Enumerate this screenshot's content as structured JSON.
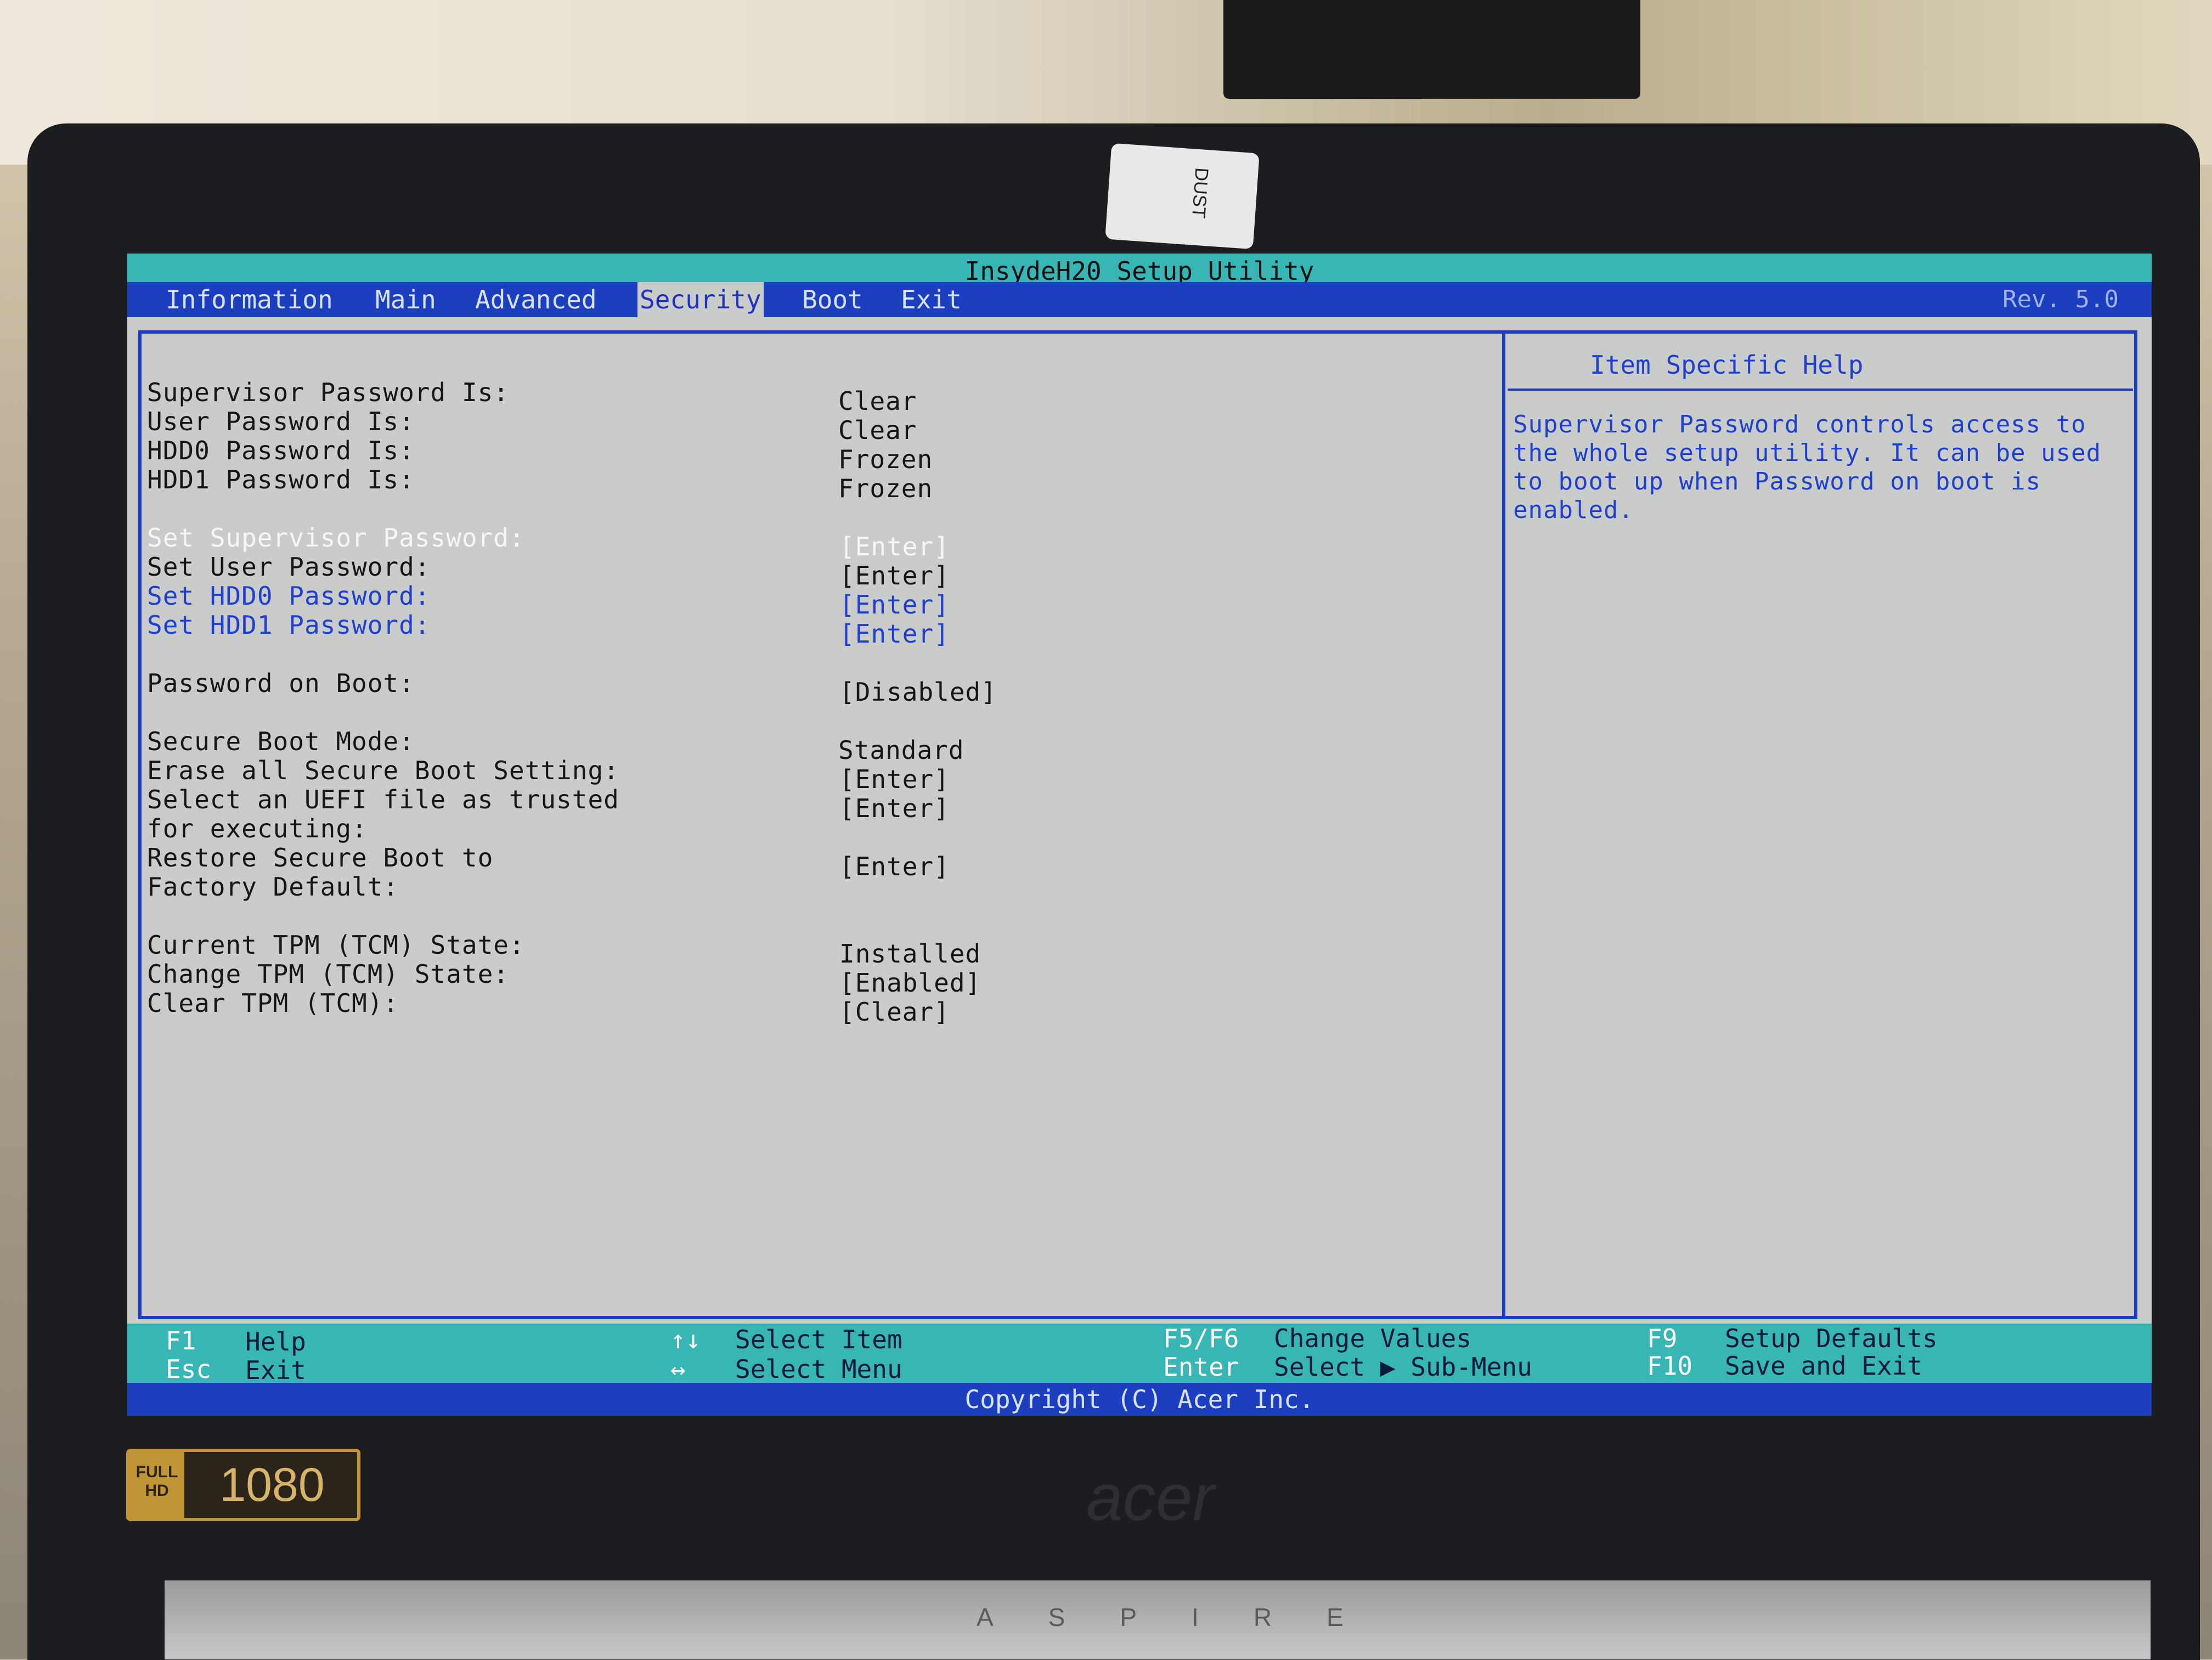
{
  "window_title": "InsydeH20 Setup Utility",
  "revision": "Rev. 5.0",
  "tabs": [
    {
      "label": "Information"
    },
    {
      "label": "Main"
    },
    {
      "label": "Advanced"
    },
    {
      "label": "Security",
      "active": true
    },
    {
      "label": "Boot"
    },
    {
      "label": "Exit"
    }
  ],
  "settings": [
    {
      "label": "Supervisor Password Is:",
      "value": "Clear"
    },
    {
      "label": "User Password Is:",
      "value": "Clear"
    },
    {
      "label": "HDD0 Password Is:",
      "value": "Frozen"
    },
    {
      "label": "HDD1 Password Is:",
      "value": "Frozen"
    },
    {
      "label": "Set Supervisor Password:",
      "value": "[Enter]",
      "selected": true
    },
    {
      "label": "Set User Password:",
      "value": "[Enter]"
    },
    {
      "label": "Set HDD0 Password:",
      "value": "[Enter]"
    },
    {
      "label": "Set HDD1 Password:",
      "value": "[Enter]"
    },
    {
      "label": "Password on Boot:",
      "value": "[Disabled]"
    },
    {
      "label": "Secure Boot Mode:",
      "value": "Standard"
    },
    {
      "label": "Erase all Secure Boot Setting:",
      "value": "[Enter]"
    },
    {
      "label": "Select an UEFI file as trusted",
      "label2": "for executing:",
      "value": "[Enter]"
    },
    {
      "label": "Restore Secure Boot to",
      "label2": "Factory Default:",
      "value": "[Enter]"
    },
    {
      "label": "Current TPM (TCM) State:",
      "value": "Installed"
    },
    {
      "label": "Change TPM (TCM) State:",
      "value": "[Enabled]"
    },
    {
      "label": "Clear TPM (TCM):",
      "value": "[Clear]"
    }
  ],
  "help": {
    "title": "Item Specific Help",
    "text": "Supervisor Password controls access to the whole setup utility. It can be used to boot up when Password on boot is enabled."
  },
  "footer": {
    "keys": [
      {
        "key": "F1",
        "desc": "Help"
      },
      {
        "key": "Esc",
        "desc": "Exit"
      },
      {
        "key": "↑↓",
        "desc": "Select Item"
      },
      {
        "key": "↔",
        "desc": "Select Menu"
      },
      {
        "key": "F5/F6",
        "desc": "Change Values"
      },
      {
        "key": "Enter",
        "desc": "Select ▶ Sub-Menu"
      },
      {
        "key": "F9",
        "desc": "Setup Defaults"
      },
      {
        "key": "F10",
        "desc": "Save and Exit"
      }
    ],
    "copyright": "Copyright (C) Acer Inc."
  },
  "bezel": {
    "sticker": "DUST",
    "badge_top": "FULL",
    "badge_bottom": "HD",
    "badge_number": "1080",
    "brand": "acer",
    "model": "ASPIRE"
  }
}
